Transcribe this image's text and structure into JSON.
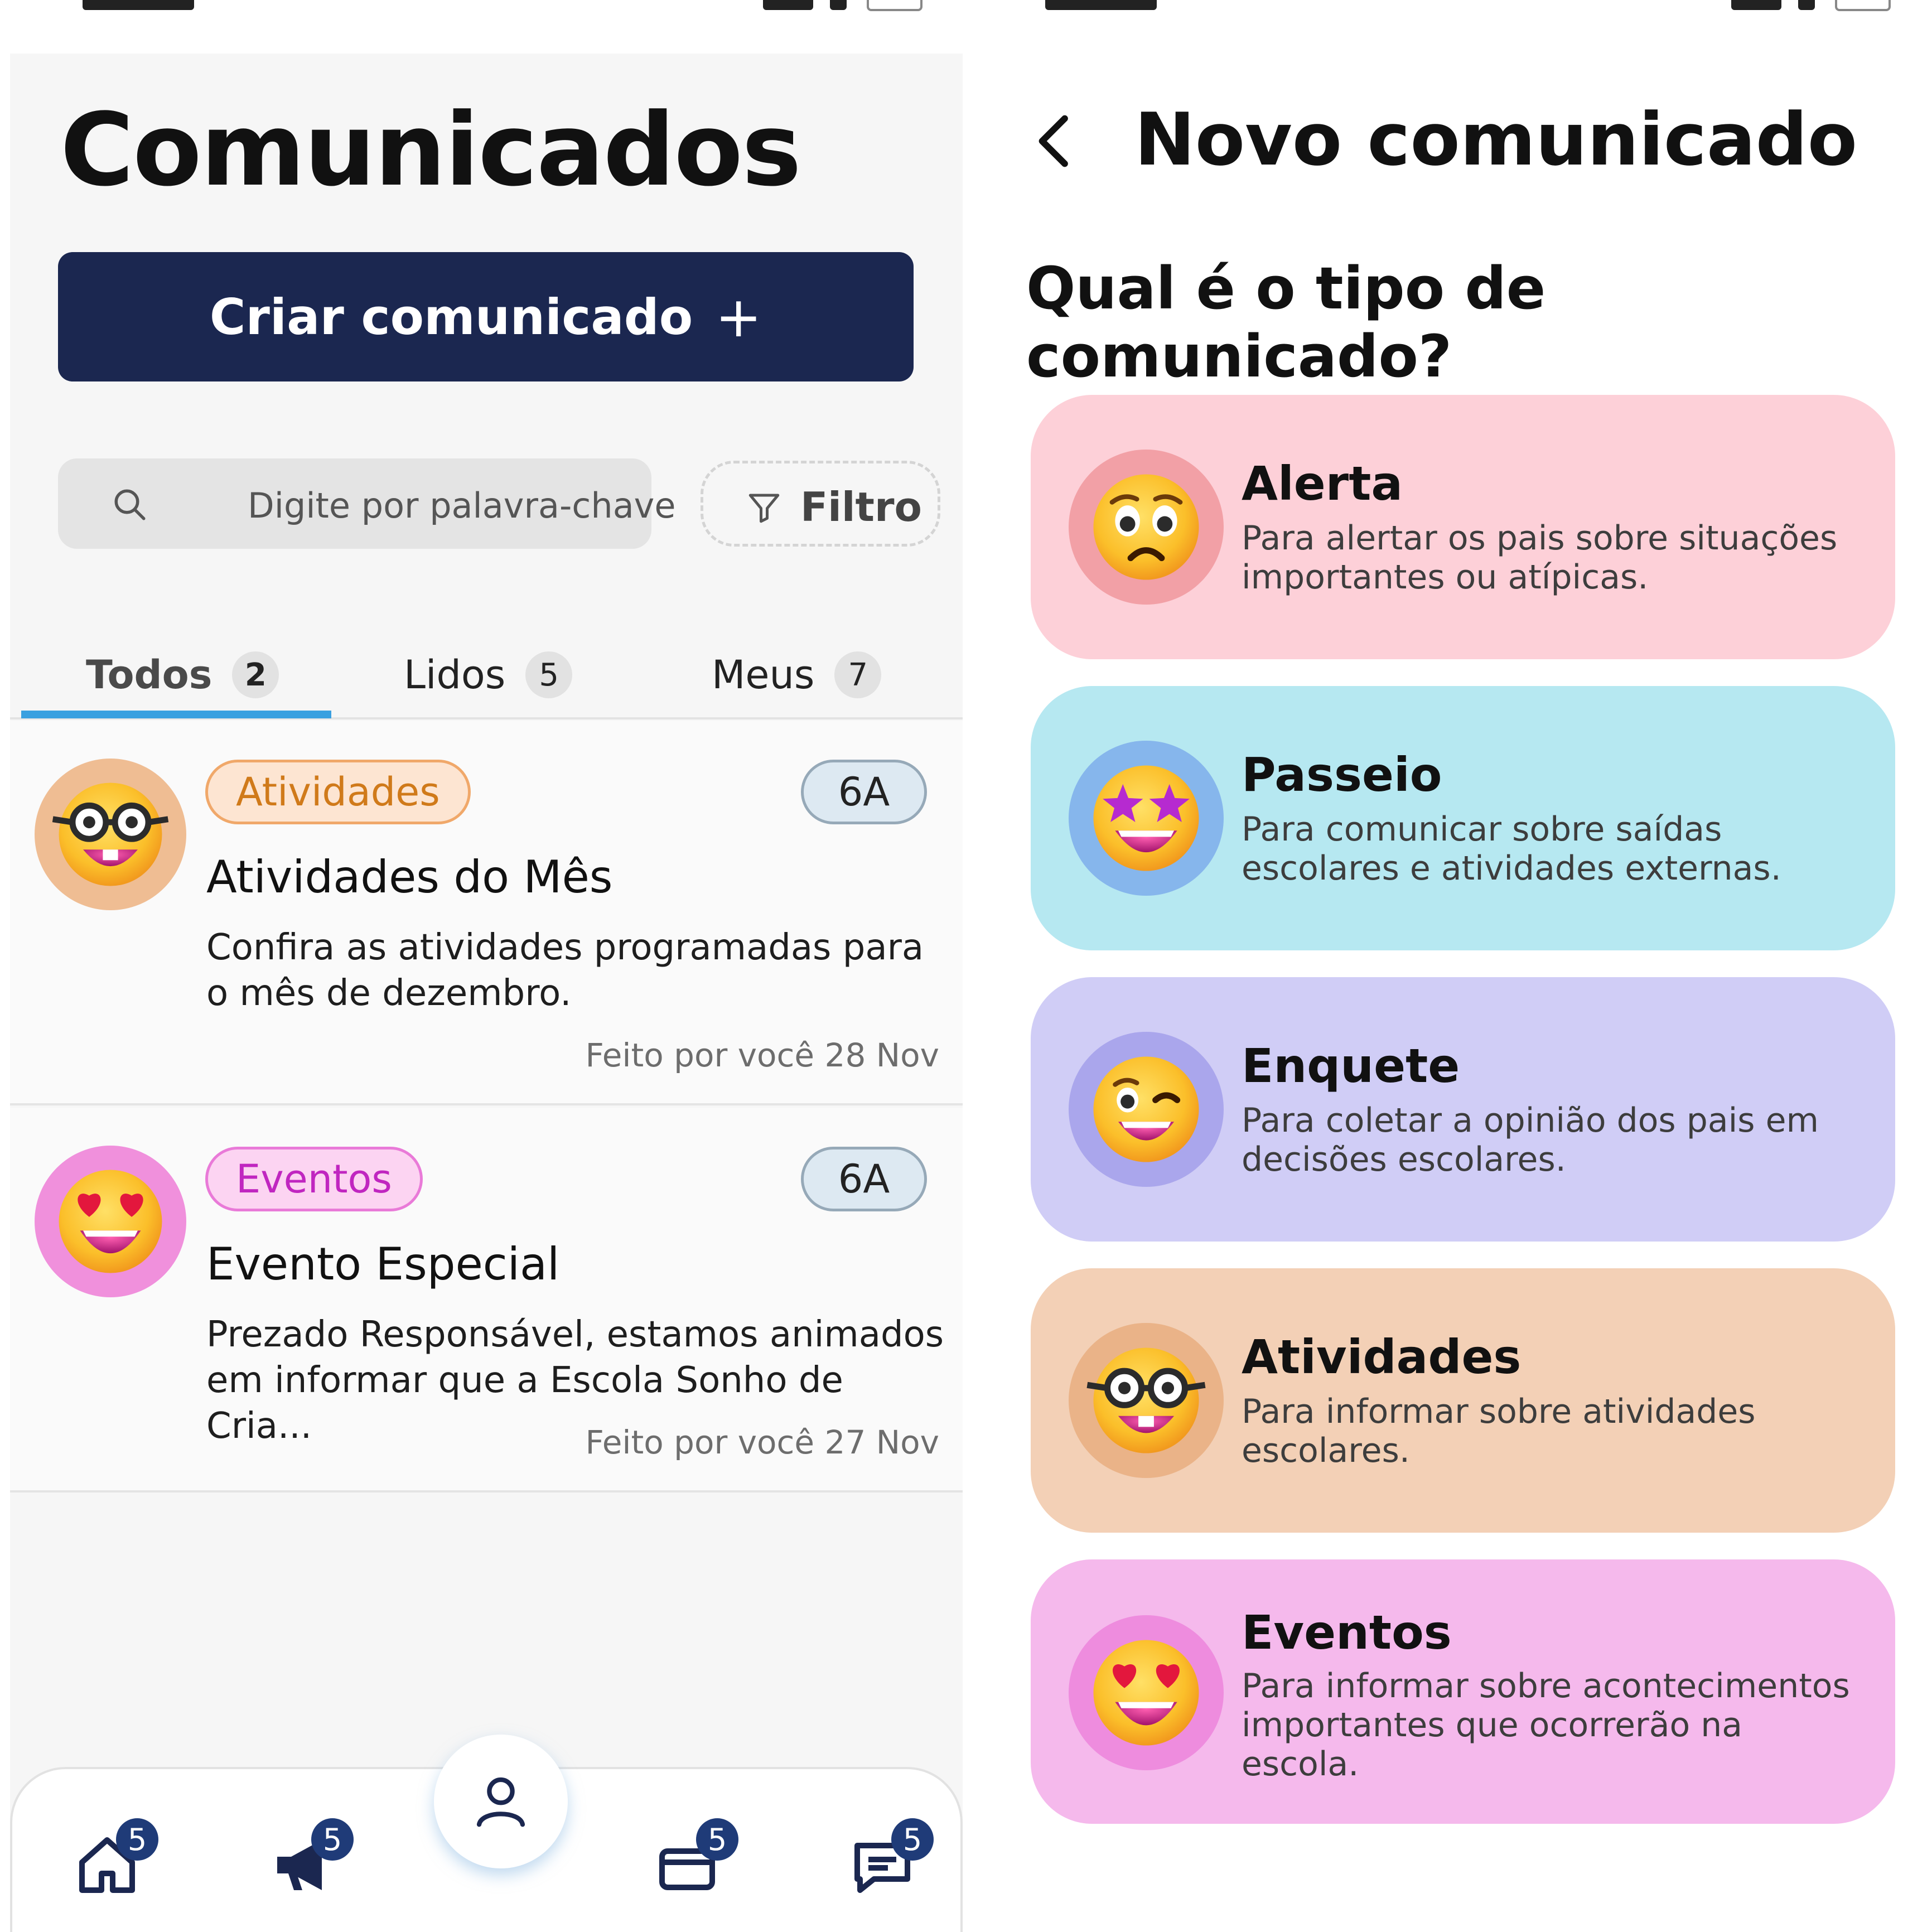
{
  "left_screen": {
    "title": "Comunicados",
    "create_button": {
      "label": "Criar comunicado",
      "icon": "plus-icon",
      "color": "#1b2750"
    },
    "search": {
      "placeholder": "Digite por palavra-chave",
      "icon": "search-icon"
    },
    "filter": {
      "label": "Filtro",
      "icon": "filter-icon"
    },
    "tabs": [
      {
        "label": "Todos",
        "count": "2",
        "active": true
      },
      {
        "label": "Lidos",
        "count": "5",
        "active": false
      },
      {
        "label": "Meus",
        "count": "7",
        "active": false
      }
    ],
    "accent_color": "#3aa0e0",
    "cards": [
      {
        "category": "Atividades",
        "category_color": "#d07a1a",
        "class": "6A",
        "title": "Atividades do Mês",
        "text": "Confira as atividades programadas para o mês de dezembro.",
        "meta": "Feito por você 28 Nov",
        "emoji": "nerd-glasses-emoji"
      },
      {
        "category": "Eventos",
        "category_color": "#c026c0",
        "class": "6A",
        "title": "Evento Especial",
        "text": "Prezado Responsável, estamos animados em informar que a Escola Sonho de Cria...",
        "meta": "Feito por você 27 Nov",
        "emoji": "heart-eyes-emoji"
      }
    ],
    "bottom_nav": [
      {
        "icon": "home-icon",
        "badge": "5"
      },
      {
        "icon": "megaphone-icon",
        "badge": "5"
      },
      {
        "icon": "profile-icon",
        "badge": ""
      },
      {
        "icon": "folder-icon",
        "badge": "5"
      },
      {
        "icon": "chat-icon",
        "badge": "5"
      }
    ]
  },
  "right_screen": {
    "title": "Novo comunicado",
    "back_icon": "chevron-left-icon",
    "question": "Qual é o tipo de comunicado?",
    "types": [
      {
        "name": "Alerta",
        "description": "Para alertar os pais sobre situações importantes ou atípicas.",
        "color": "#fdd0d8",
        "emoji": "worried-face-emoji"
      },
      {
        "name": "Passeio",
        "description": "Para comunicar sobre saídas escolares e atividades externas.",
        "color": "#b6e8f1",
        "emoji": "star-struck-emoji"
      },
      {
        "name": "Enquete",
        "description": "Para coletar a opinião dos pais em decisões escolares.",
        "color": "#d0cdf6",
        "emoji": "winking-face-emoji"
      },
      {
        "name": "Atividades",
        "description": "Para informar sobre atividades escolares.",
        "color": "#f3d0b6",
        "emoji": "nerd-glasses-emoji"
      },
      {
        "name": "Eventos",
        "description": "Para informar sobre acontecimentos importantes que ocorrerão na escola.",
        "color": "#f5b9ec",
        "emoji": "heart-eyes-emoji"
      }
    ]
  }
}
